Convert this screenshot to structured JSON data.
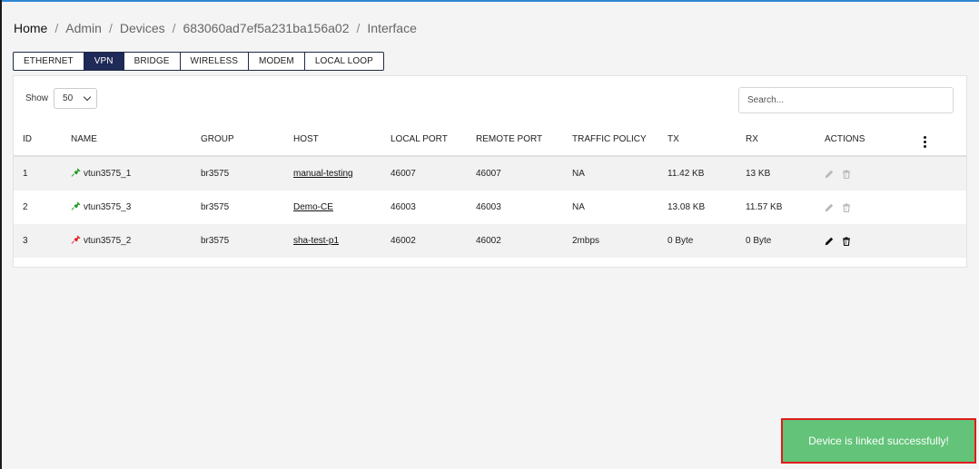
{
  "breadcrumb": [
    "Home",
    "Admin",
    "Devices",
    "683060ad7ef5a231ba156a02",
    "Interface"
  ],
  "tabs": [
    {
      "label": "ETHERNET",
      "active": false
    },
    {
      "label": "VPN",
      "active": true
    },
    {
      "label": "BRIDGE",
      "active": false
    },
    {
      "label": "WIRELESS",
      "active": false
    },
    {
      "label": "MODEM",
      "active": false
    },
    {
      "label": "LOCAL LOOP",
      "active": false
    }
  ],
  "table_controls": {
    "show_label": "Show",
    "page_size": "50",
    "search_placeholder": "Search..."
  },
  "columns": [
    "ID",
    "NAME",
    "GROUP",
    "HOST",
    "LOCAL PORT",
    "REMOTE PORT",
    "TRAFFIC POLICY",
    "TX",
    "RX",
    "ACTIONS"
  ],
  "rows": [
    {
      "id": "1",
      "name": "vtun3575_1",
      "status": "connected",
      "group": "br3575",
      "host": "manual-testing",
      "local_port": "46007",
      "remote_port": "46007",
      "traffic_policy": "NA",
      "tx": "11.42 KB",
      "rx": "13 KB",
      "actions_enabled": false
    },
    {
      "id": "2",
      "name": "vtun3575_3",
      "status": "connected",
      "group": "br3575",
      "host": "Demo-CE",
      "local_port": "46003",
      "remote_port": "46003",
      "traffic_policy": "NA",
      "tx": "13.08 KB",
      "rx": "11.57 KB",
      "actions_enabled": false
    },
    {
      "id": "3",
      "name": "vtun3575_2",
      "status": "disconnected",
      "group": "br3575",
      "host": "sha-test-p1",
      "local_port": "46002",
      "remote_port": "46002",
      "traffic_policy": "2mbps",
      "tx": "0 Byte",
      "rx": "0 Byte",
      "actions_enabled": true
    }
  ],
  "colors": {
    "accent": "#1e2a57",
    "connected": "#1f9a1f",
    "disconnected": "#e02020",
    "toast_bg": "#62c379",
    "toast_border": "#e11b1b"
  },
  "icons": {
    "status": "plug-icon",
    "edit": "pencil-icon",
    "delete": "trash-icon",
    "menu": "kebab-menu-icon",
    "dropdown": "chevron-down-icon"
  },
  "toast": {
    "message": "Device is linked successfully!"
  }
}
